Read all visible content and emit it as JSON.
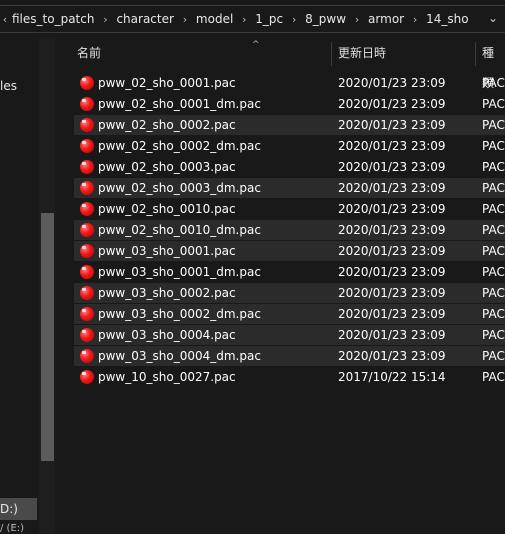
{
  "breadcrumb": {
    "chevron_left": "‹",
    "items": [
      "files_to_patch",
      "character",
      "model",
      "1_pc",
      "8_pww",
      "armor",
      "14_sho"
    ],
    "separator": "›",
    "dropdown": "⌄"
  },
  "nav": {
    "partial_label_1": "les",
    "partial_label_2": "D:)",
    "partial_label_3": "/ (E:)"
  },
  "columns": {
    "name": "名前",
    "date": "更新日時",
    "type": "種類",
    "sort_indicator": "^"
  },
  "files": [
    {
      "name": "pww_02_sho_0001.pac",
      "date": "2020/01/23 23:09",
      "type": "PAC"
    },
    {
      "name": "pww_02_sho_0001_dm.pac",
      "date": "2020/01/23 23:09",
      "type": "PAC"
    },
    {
      "name": "pww_02_sho_0002.pac",
      "date": "2020/01/23 23:09",
      "type": "PAC"
    },
    {
      "name": "pww_02_sho_0002_dm.pac",
      "date": "2020/01/23 23:09",
      "type": "PAC"
    },
    {
      "name": "pww_02_sho_0003.pac",
      "date": "2020/01/23 23:09",
      "type": "PAC"
    },
    {
      "name": "pww_02_sho_0003_dm.pac",
      "date": "2020/01/23 23:09",
      "type": "PAC"
    },
    {
      "name": "pww_02_sho_0010.pac",
      "date": "2020/01/23 23:09",
      "type": "PAC"
    },
    {
      "name": "pww_02_sho_0010_dm.pac",
      "date": "2020/01/23 23:09",
      "type": "PAC"
    },
    {
      "name": "pww_03_sho_0001.pac",
      "date": "2020/01/23 23:09",
      "type": "PAC"
    },
    {
      "name": "pww_03_sho_0001_dm.pac",
      "date": "2020/01/23 23:09",
      "type": "PAC"
    },
    {
      "name": "pww_03_sho_0002.pac",
      "date": "2020/01/23 23:09",
      "type": "PAC"
    },
    {
      "name": "pww_03_sho_0002_dm.pac",
      "date": "2020/01/23 23:09",
      "type": "PAC"
    },
    {
      "name": "pww_03_sho_0004.pac",
      "date": "2020/01/23 23:09",
      "type": "PAC"
    },
    {
      "name": "pww_03_sho_0004_dm.pac",
      "date": "2020/01/23 23:09",
      "type": "PAC"
    },
    {
      "name": "pww_10_sho_0027.pac",
      "date": "2017/10/22 15:14",
      "type": "PAC"
    }
  ],
  "file_icon": "red-gem-file-icon"
}
